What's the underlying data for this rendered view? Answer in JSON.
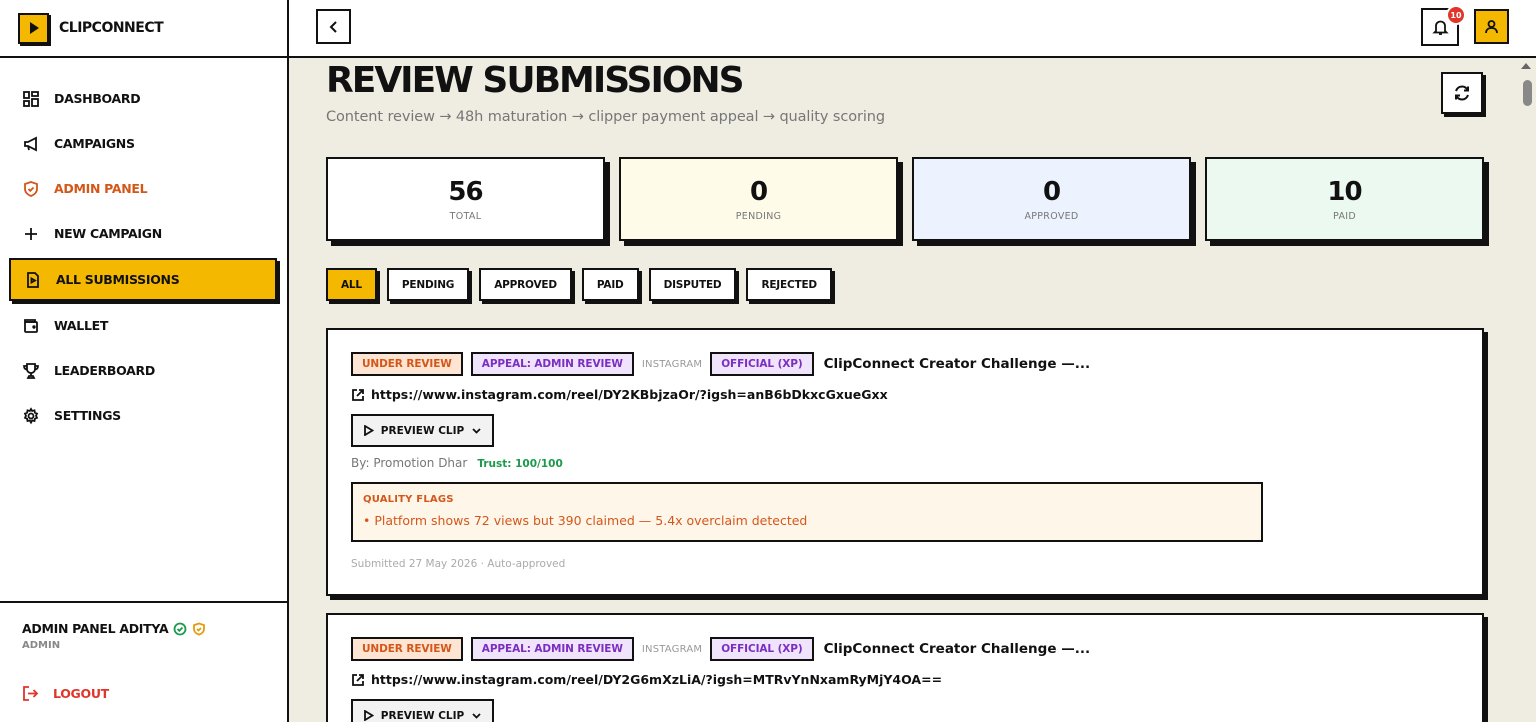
{
  "brand": {
    "name": "CLIPCONNECT"
  },
  "sidebar": {
    "items": [
      {
        "label": "DASHBOARD"
      },
      {
        "label": "CAMPAIGNS"
      },
      {
        "label": "ADMIN PANEL"
      },
      {
        "label": "NEW CAMPAIGN"
      },
      {
        "label": "ALL SUBMISSIONS"
      },
      {
        "label": "WALLET"
      },
      {
        "label": "LEADERBOARD"
      },
      {
        "label": "SETTINGS"
      }
    ],
    "user": {
      "name": "ADMIN PANEL ADITYA",
      "role": "ADMIN"
    },
    "logout_label": "LOGOUT"
  },
  "topbar": {
    "notification_count": "10"
  },
  "page": {
    "title": "REVIEW SUBMISSIONS",
    "subtitle": "Content review → 48h maturation → clipper payment appeal → quality scoring"
  },
  "stats": [
    {
      "value": "56",
      "label": "TOTAL",
      "bg": "#ffffff"
    },
    {
      "value": "0",
      "label": "PENDING",
      "bg": "#fefbe9"
    },
    {
      "value": "0",
      "label": "APPROVED",
      "bg": "#edf3fe"
    },
    {
      "value": "10",
      "label": "PAID",
      "bg": "#ecf9f0"
    }
  ],
  "filters": [
    {
      "label": "ALL",
      "active": true
    },
    {
      "label": "PENDING"
    },
    {
      "label": "APPROVED"
    },
    {
      "label": "PAID"
    },
    {
      "label": "DISPUTED"
    },
    {
      "label": "REJECTED"
    }
  ],
  "submissions": [
    {
      "status": "UNDER REVIEW",
      "appeal": "APPEAL: ADMIN REVIEW",
      "platform": "INSTAGRAM",
      "type": "OFFICIAL (XP)",
      "campaign": "ClipConnect Creator Challenge —...",
      "url": "https://www.instagram.com/reel/DY2KBbjzaOr/?igsh=anB6bDkxcGxueGxx",
      "preview_label": "PREVIEW CLIP",
      "by": "By: Promotion Dhar",
      "trust": "Trust: 100/100",
      "flags_title": "QUALITY FLAGS",
      "flag": "• Platform shows 72 views but 390 claimed — 5.4x overclaim detected",
      "submitted": "Submitted 27 May 2026 · Auto-approved"
    },
    {
      "status": "UNDER REVIEW",
      "appeal": "APPEAL: ADMIN REVIEW",
      "platform": "INSTAGRAM",
      "type": "OFFICIAL (XP)",
      "campaign": "ClipConnect Creator Challenge —...",
      "url": "https://www.instagram.com/reel/DY2G6mXzLiA/?igsh=MTRvYnNxamRyMjY4OA==",
      "preview_label": "PREVIEW CLIP"
    }
  ]
}
